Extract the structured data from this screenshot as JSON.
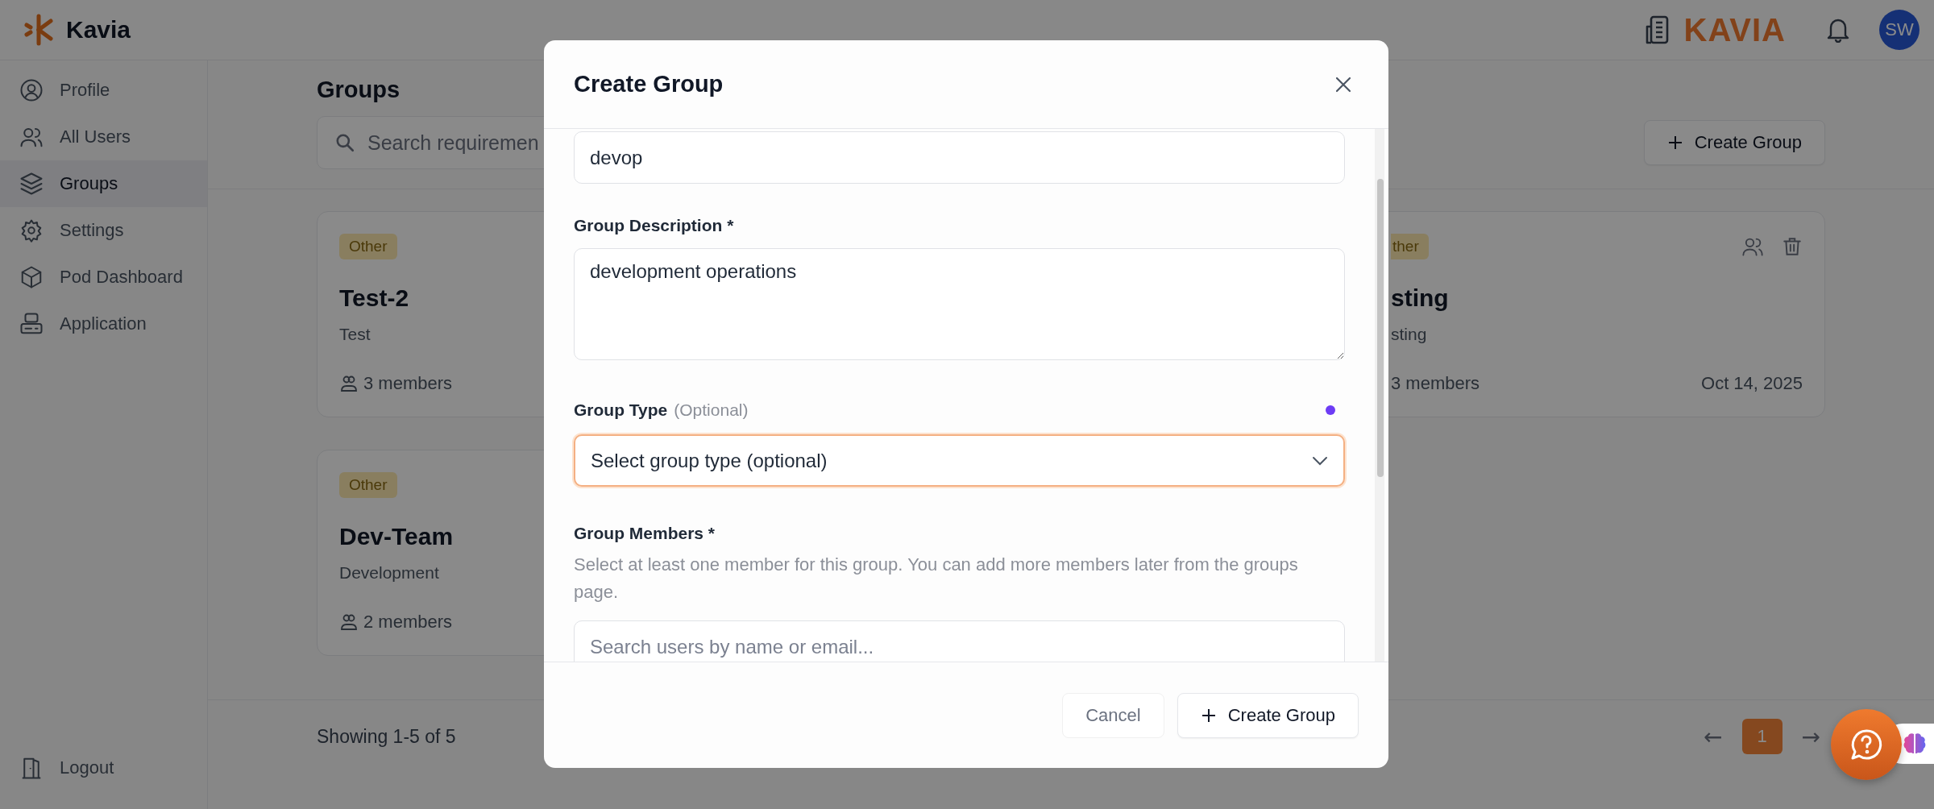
{
  "header": {
    "logo_text": "Kavia",
    "brand": "KAVIA",
    "avatar_initials": "SW"
  },
  "sidebar": {
    "items": [
      {
        "label": "Profile",
        "selected": false
      },
      {
        "label": "All Users",
        "selected": false
      },
      {
        "label": "Groups",
        "selected": true
      },
      {
        "label": "Settings",
        "selected": false
      },
      {
        "label": "Pod Dashboard",
        "selected": false
      },
      {
        "label": "Application",
        "selected": false
      }
    ],
    "logout": "Logout"
  },
  "page": {
    "title": "Groups",
    "search_placeholder": "Search requiremen",
    "create_button": "Create Group",
    "cards": [
      {
        "kind": "full",
        "tag": "Other",
        "title": "Test-2",
        "description": "Test",
        "members": "3 members"
      },
      {
        "kind": "covered",
        "tag": "ther",
        "title": "sting",
        "description": "sting",
        "members": "3 members",
        "date": "Oct 14, 2025"
      },
      {
        "kind": "full",
        "tag": "Other",
        "title": "Dev-Team",
        "description": "Development",
        "members": "2 members"
      }
    ],
    "summary": "Showing 1-5 of 5",
    "pagination": {
      "prev": "←",
      "next": "→",
      "pages": [
        {
          "label": "1",
          "selected": true
        }
      ]
    }
  },
  "modal": {
    "title": "Create Group",
    "name_value": "devop",
    "description_label": "Group Description *",
    "description_value": "development operations",
    "type_label": "Group Type",
    "type_hint": "(Optional)",
    "type_placeholder": "Select group type (optional)",
    "type_focused": true,
    "members_label": "Group Members *",
    "members_help": "Select at least one member for this group. You can add more members later from the groups page.",
    "members_search_placeholder": "Search users by name or email...",
    "cancel": "Cancel",
    "submit": "Create Group"
  }
}
